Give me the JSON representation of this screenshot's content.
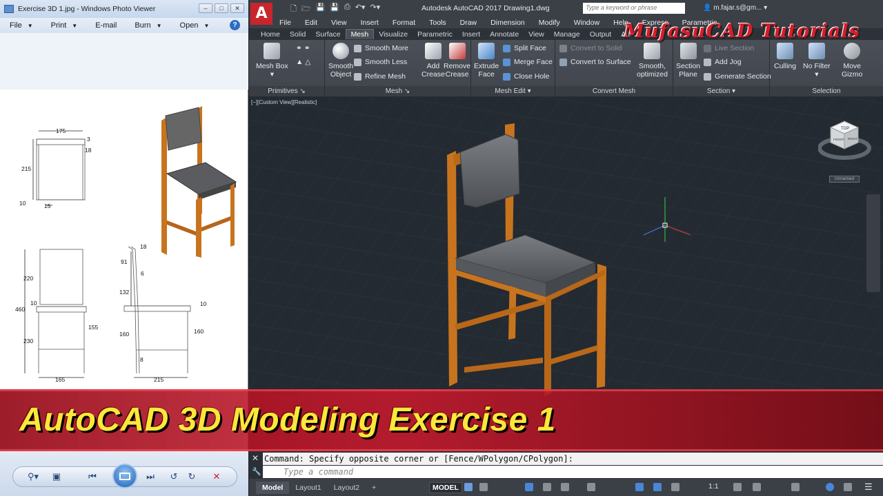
{
  "photo_viewer": {
    "title": "Exercise 3D 1.jpg - Windows Photo Viewer",
    "menu": [
      "File",
      "Print",
      "E-mail",
      "Burn",
      "Open"
    ],
    "help": "?",
    "drawing_dims": {
      "front_width": "175",
      "top_offset": "3",
      "side_offset": "18",
      "height_back": "215",
      "leg_left": "10",
      "leg_gap": "15",
      "back_height": "220",
      "seat_total": "460",
      "seat_thick": "10",
      "lower": "230",
      "rail": "155",
      "front_base": "165",
      "side_top": "18",
      "side_91": "91",
      "side_6": "6",
      "side_132": "132",
      "side_10": "10",
      "side_160a": "160",
      "side_160b": "160",
      "side_8": "8",
      "side_base": "215"
    }
  },
  "autocad": {
    "logo": "A",
    "title": "Autodesk AutoCAD 2017    Drawing1.dwg",
    "search_placeholder": "Type a keyword or phrase",
    "user": "m.fajar.s@gm...",
    "menubar": [
      "File",
      "Edit",
      "View",
      "Insert",
      "Format",
      "Tools",
      "Draw",
      "Dimension",
      "Modify",
      "Window",
      "Help",
      "Express",
      "Parametric"
    ],
    "tabs": [
      "Home",
      "Solid",
      "Surface",
      "Mesh",
      "Visualize",
      "Parametric",
      "Insert",
      "Annotate",
      "View",
      "Manage",
      "Output",
      "Ad"
    ],
    "active_tab": "Mesh",
    "ribbon": {
      "primitives": {
        "mesh_box": "Mesh Box",
        "label": "Primitives"
      },
      "mesh": {
        "smooth_object_1": "Smooth",
        "smooth_object_2": "Object",
        "smooth_more": "Smooth More",
        "smooth_less": "Smooth Less",
        "refine_mesh": "Refine Mesh",
        "add_crease_1": "Add",
        "add_crease_2": "Crease",
        "remove_crease_1": "Remove",
        "remove_crease_2": "Crease",
        "label": "Mesh"
      },
      "mesh_edit": {
        "extrude_1": "Extrude",
        "extrude_2": "Face",
        "split_face": "Split Face",
        "merge_face": "Merge Face",
        "close_hole": "Close Hole",
        "label": "Mesh Edit"
      },
      "convert_mesh": {
        "to_solid": "Convert to Solid",
        "to_surface": "Convert to Surface",
        "smooth_opt_1": "Smooth,",
        "smooth_opt_2": "optimized",
        "label": "Convert Mesh"
      },
      "section": {
        "plane_1": "Section",
        "plane_2": "Plane",
        "live_section": "Live Section",
        "add_jog": "Add Jog",
        "generate": "Generate Section",
        "label": "Section"
      },
      "selection": {
        "culling": "Culling",
        "no_filter": "No Filter",
        "gizmo_1": "Move",
        "gizmo_2": "Gizmo",
        "label": "Selection"
      }
    },
    "watermark": "MufasuCAD Tutorials",
    "viewport_label": "[−][Custom View][Realistic]",
    "viewcube": {
      "top": "TOP",
      "front": "FRONT",
      "right": "RIGHT",
      "unnamed": "Unnamed"
    },
    "command_history": "Command: Specify opposite corner or [Fence/WPolygon/CPolygon]:",
    "command_placeholder": "Type a command",
    "layouts": [
      "Model",
      "Layout1",
      "Layout2",
      "+"
    ],
    "status_model": "MODEL",
    "status_scale": "1:1"
  },
  "banner": {
    "text": "AutoCAD 3D Modeling Exercise 1"
  },
  "colors": {
    "wood": "#c8741e",
    "cushion": "#5a5c60",
    "banner": "#c81a2d",
    "banner_text": "#ffe73a"
  }
}
